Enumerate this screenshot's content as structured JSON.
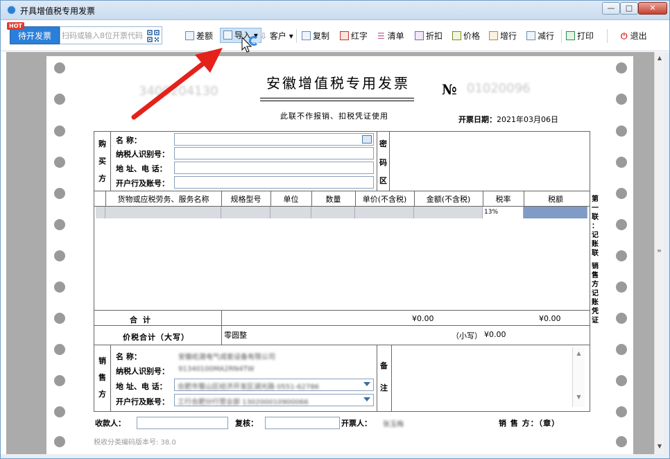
{
  "window": {
    "title": "开具增值税专用发票",
    "min": "—",
    "max": "□",
    "close": "✕"
  },
  "toolbar": {
    "hot": "HOT",
    "pending": "待开发票",
    "scan_placeholder": "扫码或输入8位开票代码",
    "buttons": {
      "diff": "差额",
      "import": "导入",
      "client": "客户",
      "copy": "复制",
      "red": "红字",
      "list": "清单",
      "discount": "折扣",
      "price": "价格",
      "add_row": "增行",
      "del_row": "减行",
      "print": "打印",
      "exit": "退出"
    }
  },
  "invoice": {
    "title": "安徽增值税专用发票",
    "code": "3400204130",
    "no_label": "№",
    "number": "01020096",
    "subtitle": "此联不作报销、扣税凭证使用",
    "date_label": "开票日期：",
    "date": "2021年03月06日",
    "buyer": {
      "side": [
        "购",
        "买",
        "方"
      ],
      "name": "名        称：",
      "tax_id": "纳税人识别号：",
      "address": "地 址、电 话：",
      "bank": "开户行及账号："
    },
    "cipher": [
      "密",
      "码",
      "区"
    ],
    "columns": [
      "货物或应税劳务、服务名称",
      "规格型号",
      "单位",
      "数量",
      "单价(不含税)",
      "金额(不含税)",
      "税率",
      "税额"
    ],
    "row": {
      "rate": "13%"
    },
    "total_label": "合      计",
    "total_amount": "¥0.00",
    "total_tax": "¥0.00",
    "pricetax_label": "价税合计（大写）",
    "pricetax_upper": "零圆整",
    "small_label": "（小写）",
    "pricetax_lower": "¥0.00",
    "seller": {
      "side": [
        "销",
        "售",
        "方"
      ],
      "name": "名        称：",
      "tax_id": "纳税人识别号：",
      "address": "地 址、电 话：",
      "bank": "开户行及账号：",
      "name_value": "安徽屹晟电气成套设备有限公司",
      "tax_value": "91340100MA2RN4TW",
      "address_value": "合肥市蜀山区经济开发区湖光路 0551-62786",
      "bank_value": "工行合肥分行营业部 130200010900066"
    },
    "remark": [
      "备",
      "注"
    ],
    "side_copy": [
      "第",
      "一",
      "联",
      "：",
      "记",
      "账",
      "联",
      "",
      "销",
      "售",
      "方",
      "记",
      "账",
      "凭",
      "证"
    ],
    "payee": "收款人：",
    "reviewer": "复核：",
    "drawer": "开票人：",
    "drawer_value": "张玉梅",
    "seller_stamp": "销 售 方：（章）",
    "version": "税收分类编码版本号: 38.0"
  },
  "colors": {
    "accent": "#2b7fd8",
    "arrow": "#e4211a",
    "paper_bg": "#ababab"
  }
}
